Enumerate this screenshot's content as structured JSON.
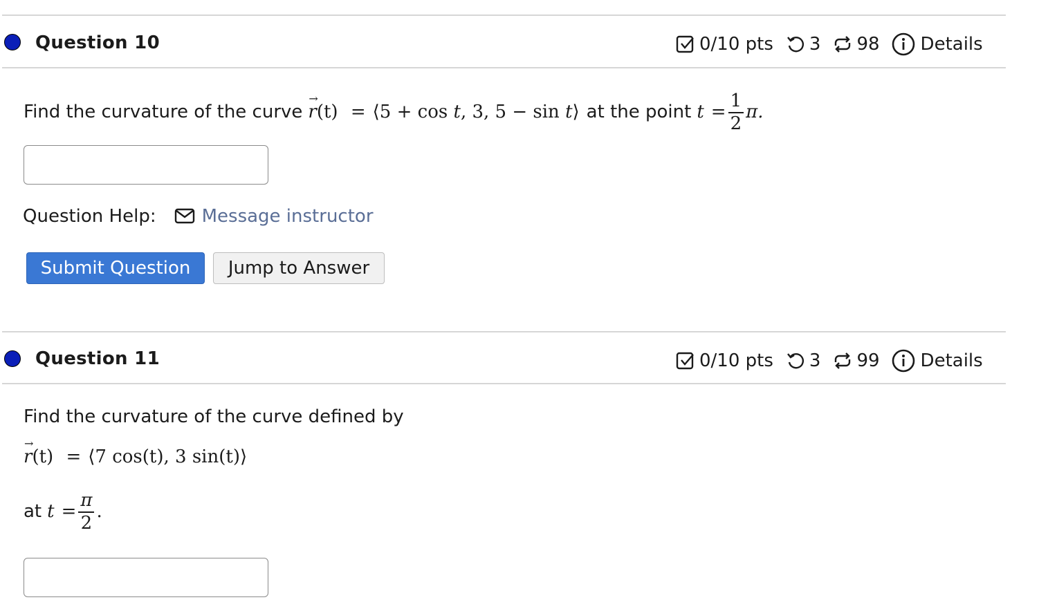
{
  "questions": [
    {
      "title": "Question 10",
      "points": "0/10 pts",
      "tries": "3",
      "regen": "98",
      "details": "Details",
      "prompt": {
        "lead": "Find the curvature of the curve",
        "func_r": "r",
        "func_t": "(t)",
        "eq": "=",
        "expr_open": "⟨5 + cos ",
        "expr_t1": "t",
        "expr_mid": ", 3, 5 − sin ",
        "expr_t2": "t",
        "expr_close": "⟩",
        "at_text": "at the point",
        "var": "t",
        "eq2": "=",
        "frac_num": "1",
        "frac_den": "2",
        "pi": "π."
      },
      "answer_value": "",
      "help_label": "Question Help:",
      "help_link": "Message instructor",
      "submit_label": "Submit Question",
      "jump_label": "Jump to Answer"
    },
    {
      "title": "Question 11",
      "points": "0/10 pts",
      "tries": "3",
      "regen": "99",
      "details": "Details",
      "prompt": {
        "lead": "Find the curvature of the curve defined by",
        "func_r": "r",
        "func_t": "(t)",
        "eq": "=",
        "expr": "⟨7 cos(t), 3 sin(t)⟩",
        "at_text": "at",
        "var": "t",
        "eq2": "=",
        "frac_num": "π",
        "frac_den": "2",
        "period": "."
      },
      "answer_value": ""
    }
  ],
  "icons": {
    "status_dot": "filled-circle-icon",
    "points": "checkbox-icon",
    "tries": "retry-icon",
    "regen": "regenerate-icon",
    "details": "info-icon",
    "message": "envelope-icon"
  },
  "colors": {
    "status_dot": "#0b1fb8",
    "primary_button": "#3a78d4",
    "link": "#5a6e96"
  }
}
